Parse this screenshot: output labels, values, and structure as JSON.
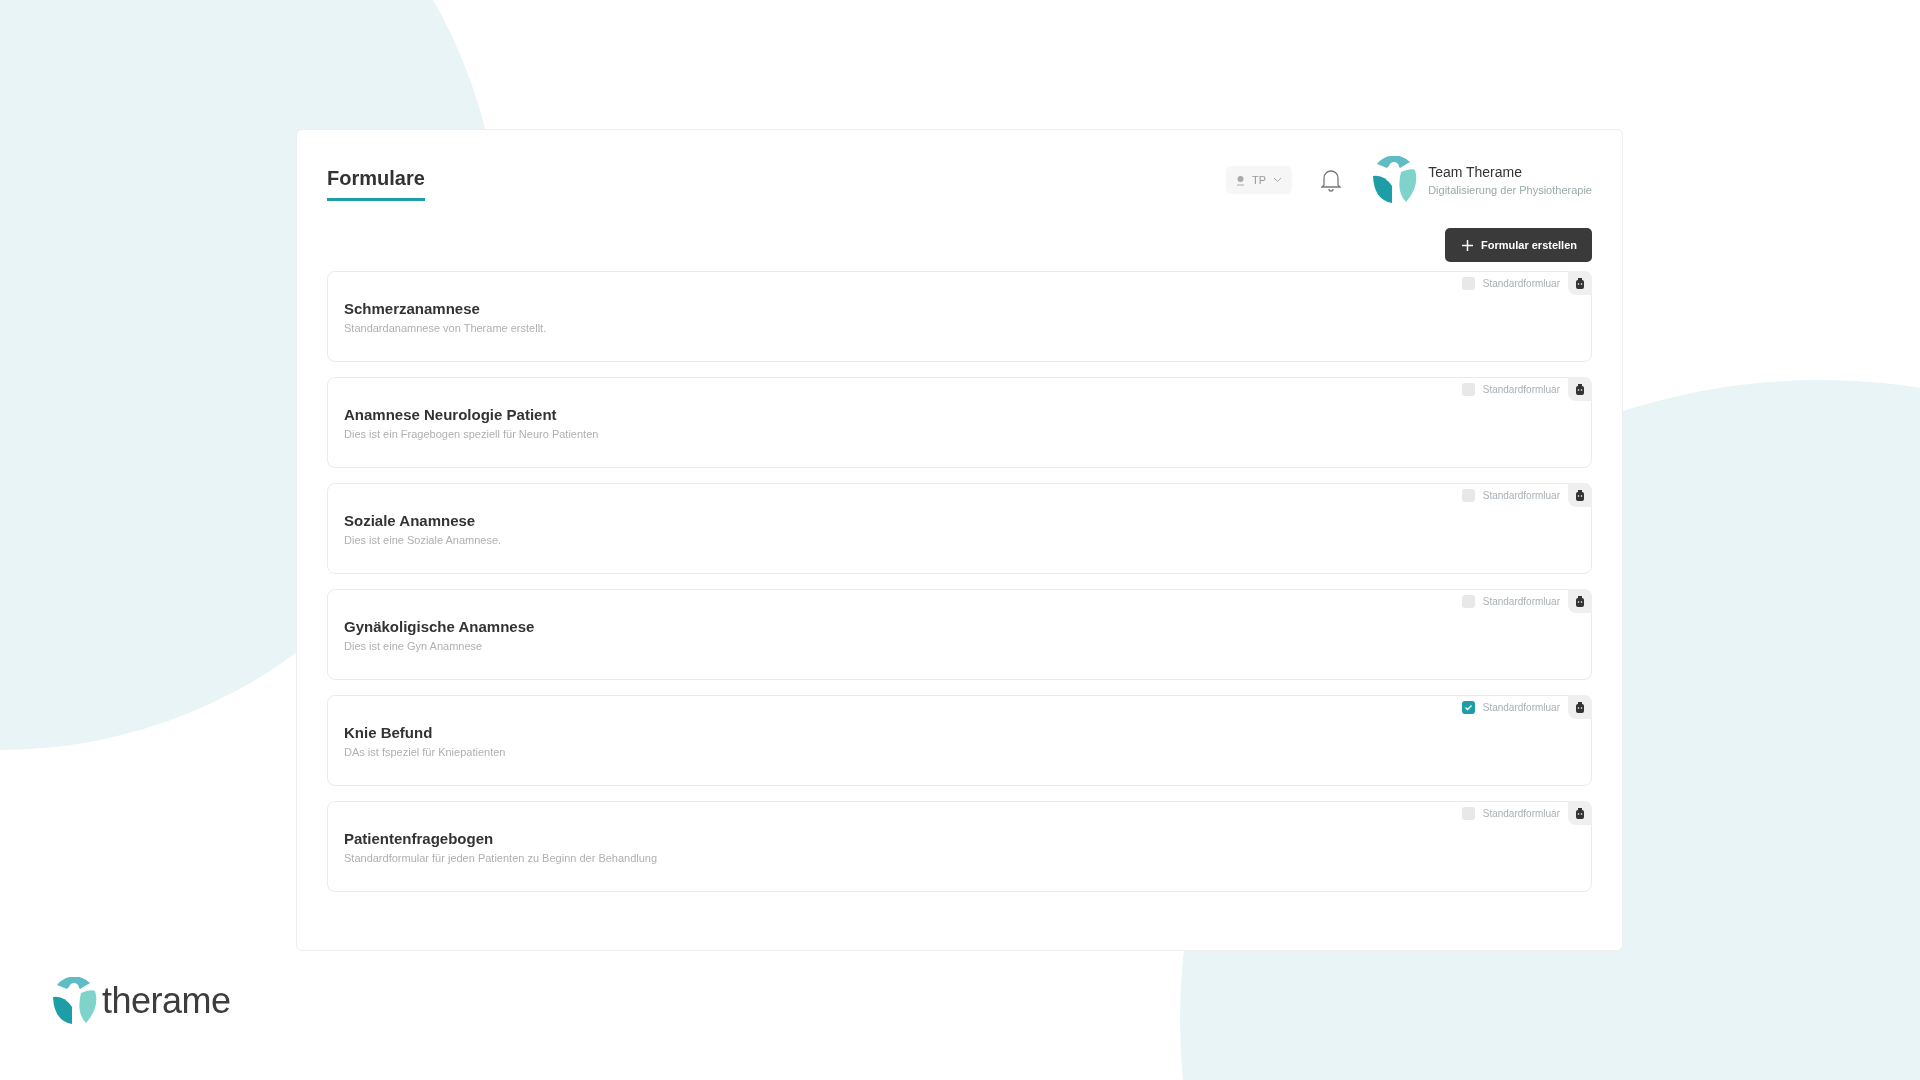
{
  "header": {
    "title": "Formulare",
    "location_selector": {
      "value": "TP"
    },
    "user": {
      "name": "Team Therame",
      "subtitle": "Digitalisierung der Physiotherapie"
    }
  },
  "create_button": {
    "label": "Formular erstellen"
  },
  "forms": [
    {
      "title": "Schmerzanamnese",
      "description": "Standardanamnese von Therame erstellt.",
      "default_label": "Standardformluar",
      "checked": false
    },
    {
      "title": "Anamnese Neurologie Patient",
      "description": "Dies ist ein Fragebogen speziell für Neuro Patienten",
      "default_label": "Standardformluar",
      "checked": false
    },
    {
      "title": "Soziale Anamnese",
      "description": "Dies ist eine Soziale Anamnese.",
      "default_label": "Standardformluar",
      "checked": false
    },
    {
      "title": "Gynäkoligische Anamnese",
      "description": "Dies ist eine Gyn Anamnese",
      "default_label": "Standardformluar",
      "checked": false
    },
    {
      "title": "Knie Befund",
      "description": "DAs ist fspeziel für Kniepatienten",
      "default_label": "Standardformluar",
      "checked": true
    },
    {
      "title": "Patientenfragebogen",
      "description": "Standardformular für jeden Patienten zu Beginn der Behandlung",
      "default_label": "Standardformluar",
      "checked": false
    }
  ],
  "brand": {
    "wordmark": "therame"
  }
}
